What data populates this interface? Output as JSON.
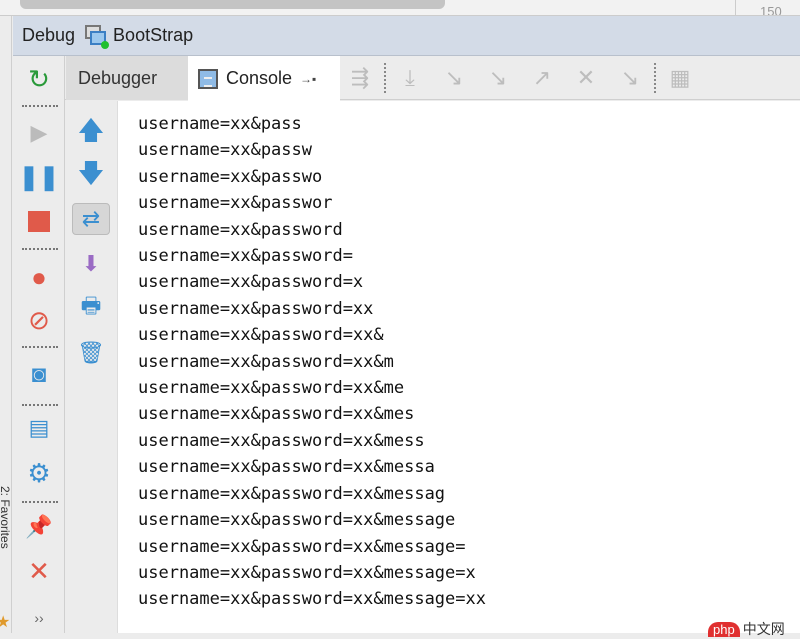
{
  "window": {
    "top_line_number": "150"
  },
  "side_strip": {
    "label": "2: Favorites"
  },
  "header": {
    "title": "Debug",
    "config_name": "BootStrap"
  },
  "tabs": [
    {
      "label": "Debugger",
      "active": false
    },
    {
      "label": "Console",
      "active": true
    }
  ],
  "console": {
    "lines": [
      "username=xx&pass",
      "username=xx&passw",
      "username=xx&passwo",
      "username=xx&passwor",
      "username=xx&password",
      "username=xx&password=",
      "username=xx&password=x",
      "username=xx&password=xx",
      "username=xx&password=xx&",
      "username=xx&password=xx&m",
      "username=xx&password=xx&me",
      "username=xx&password=xx&mes",
      "username=xx&password=xx&mess",
      "username=xx&password=xx&messa",
      "username=xx&password=xx&messag",
      "username=xx&password=xx&message",
      "username=xx&password=xx&message=",
      "username=xx&password=xx&message=x",
      "username=xx&password=xx&message=xx"
    ]
  },
  "left_toolbar": [
    "rerun-icon",
    "resume-icon",
    "pause-icon",
    "stop-icon",
    "view-breakpoints-icon",
    "mute-breakpoints-icon",
    "snapshot-icon",
    "restore-layout-icon",
    "settings-icon",
    "pin-icon",
    "close-icon",
    "more-icon"
  ],
  "console_toolbar": [
    "up-arrow-icon",
    "down-arrow-icon",
    "soft-wrap-icon",
    "scroll-to-end-icon",
    "print-icon",
    "clear-all-icon"
  ],
  "watermark": {
    "text": "php中文网"
  },
  "colors": {
    "header_bg": "#d3dbe7",
    "accent_blue": "#3b8fd0",
    "stop_red": "#e05a4a"
  }
}
